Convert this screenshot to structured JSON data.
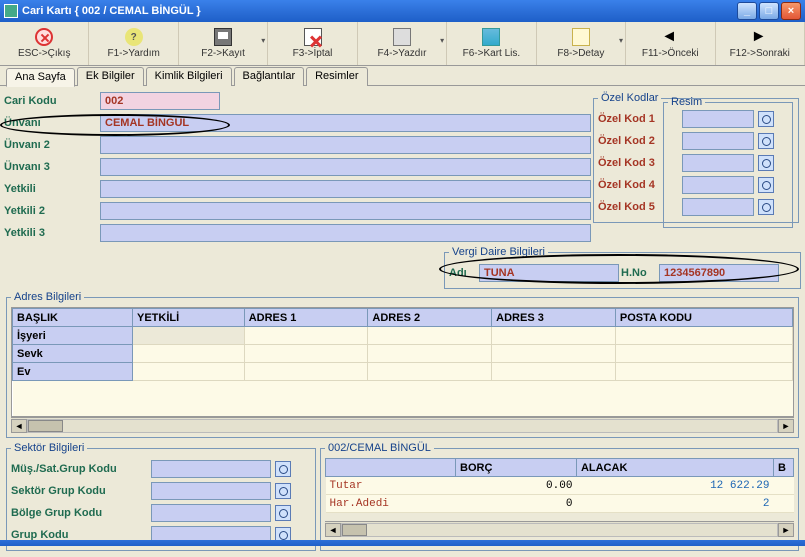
{
  "window": {
    "title": "Cari Kartı { 002 / CEMAL BİNGÜL }"
  },
  "toolbar": {
    "esc": "ESC->Çıkış",
    "f1": "F1->Yardım",
    "f2": "F2->Kayıt",
    "f3": "F3->İptal",
    "f4": "F4->Yazdır",
    "f6": "F6->Kart Lis.",
    "f8": "F8->Detay",
    "f11": "F11->Önceki",
    "f12": "F12->Sonraki"
  },
  "tabs": {
    "ana": "Ana Sayfa",
    "ek": "Ek Bilgiler",
    "kimlik": "Kimlik Bilgileri",
    "bag": "Bağlantılar",
    "resim": "Resimler"
  },
  "labels": {
    "cari_kodu": "Cari Kodu",
    "unvani": "Ünvanı",
    "unvani2": "Ünvanı 2",
    "unvani3": "Ünvanı 3",
    "yetkili": "Yetkili",
    "yetkili2": "Yetkili 2",
    "yetkili3": "Yetkili 3"
  },
  "fields": {
    "cari_kodu": "002",
    "unvani": "CEMAL BİNGÜL",
    "unvani2": "",
    "unvani3": "",
    "yetkili": "",
    "yetkili2": "",
    "yetkili3": ""
  },
  "ozel": {
    "legend": "Özel Kodlar",
    "k1": "Özel Kod 1",
    "k2": "Özel Kod 2",
    "k3": "Özel Kod 3",
    "k4": "Özel Kod 4",
    "k5": "Özel Kod 5"
  },
  "vergi": {
    "legend": "Vergi Daire Bilgileri",
    "adi_label": "Adı",
    "adi_value": "TUNA",
    "hno_label": "H.No",
    "hno_value": "1234567890"
  },
  "resim_legend": "Resim",
  "adres": {
    "legend": "Adres Bilgileri",
    "headers": {
      "baslik": "BAŞLIK",
      "yetkili": "YETKİLİ",
      "a1": "ADRES 1",
      "a2": "ADRES 2",
      "a3": "ADRES 3",
      "pk": "POSTA KODU"
    },
    "rows": {
      "isyeri": "İşyeri",
      "sevk": "Sevk",
      "ev": "Ev"
    }
  },
  "sektor": {
    "legend": "Sektör Bilgileri",
    "mus": "Müş./Sat.Grup Kodu",
    "sek": "Sektör Grup Kodu",
    "bolge": "Bölge Grup Kodu",
    "grup": "Grup Kodu"
  },
  "borc": {
    "legend": "002/CEMAL BİNGÜL",
    "headers": {
      "empty": "",
      "borc": "BORÇ",
      "alacak": "ALACAK",
      "b": "B"
    },
    "rows": [
      {
        "label": "Tutar",
        "borc": "0.00",
        "alacak": "12 622.29"
      },
      {
        "label": "Har.Adedi",
        "borc": "0",
        "alacak": "2"
      }
    ]
  }
}
